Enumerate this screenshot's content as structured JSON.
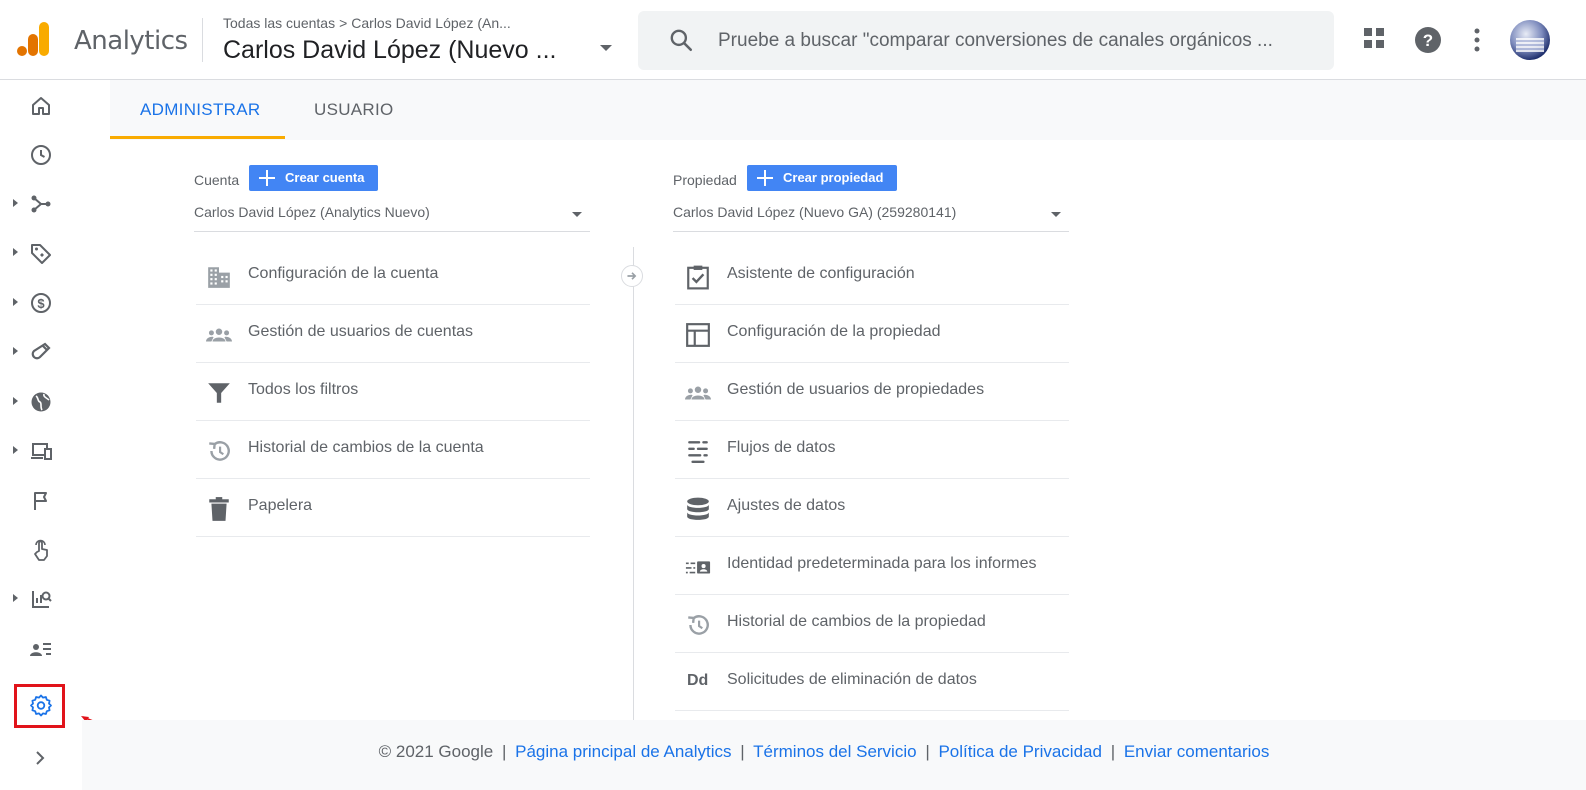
{
  "header": {
    "app_name": "Analytics",
    "breadcrumb_root": "Todas las cuentas",
    "breadcrumb_sep": ">",
    "breadcrumb_account": "Carlos David López (An...",
    "account_title": "Carlos David López (Nuevo ...",
    "search_placeholder": "Pruebe a buscar \"comparar conversiones de canales orgánicos ..."
  },
  "tabs": {
    "admin": "ADMINISTRAR",
    "user": "USUARIO"
  },
  "account_col": {
    "label": "Cuenta",
    "create_label": "Crear cuenta",
    "selected": "Carlos David López (Analytics Nuevo)",
    "items": [
      {
        "label": "Configuración de la cuenta",
        "icon": "building-icon"
      },
      {
        "label": "Gestión de usuarios de cuentas",
        "icon": "people-icon"
      },
      {
        "label": "Todos los filtros",
        "icon": "filter-icon"
      },
      {
        "label": "Historial de cambios de la cuenta",
        "icon": "history-icon"
      },
      {
        "label": "Papelera",
        "icon": "trash-icon"
      }
    ]
  },
  "property_col": {
    "label": "Propiedad",
    "create_label": "Crear propiedad",
    "selected": "Carlos David López (Nuevo GA) (259280141)",
    "items": [
      {
        "label": "Asistente de configuración",
        "icon": "checklist-icon"
      },
      {
        "label": "Configuración de la propiedad",
        "icon": "layout-icon"
      },
      {
        "label": "Gestión de usuarios de propiedades",
        "icon": "people-icon"
      },
      {
        "label": "Flujos de datos",
        "icon": "streams-icon"
      },
      {
        "label": "Ajustes de datos",
        "icon": "database-icon"
      },
      {
        "label": "Identidad predeterminada para los informes",
        "icon": "identity-icon"
      },
      {
        "label": "Historial de cambios de la propiedad",
        "icon": "history-icon"
      },
      {
        "label": "Solicitudes de eliminación de datos",
        "icon": "dd-icon",
        "icon_text": "Dd"
      }
    ]
  },
  "footer": {
    "copyright": "© 2021 Google",
    "sep": "|",
    "links": [
      "Página principal de Analytics",
      "Términos del Servicio",
      "Política de Privacidad",
      "Enviar comentarios"
    ]
  },
  "colors": {
    "accent": "#1a73e8",
    "button": "#4285f4",
    "tab_underline": "#f9ab00",
    "highlight_box": "#e1131a",
    "logo_orange": "#f9ab00",
    "logo_dark_orange": "#e37400"
  }
}
